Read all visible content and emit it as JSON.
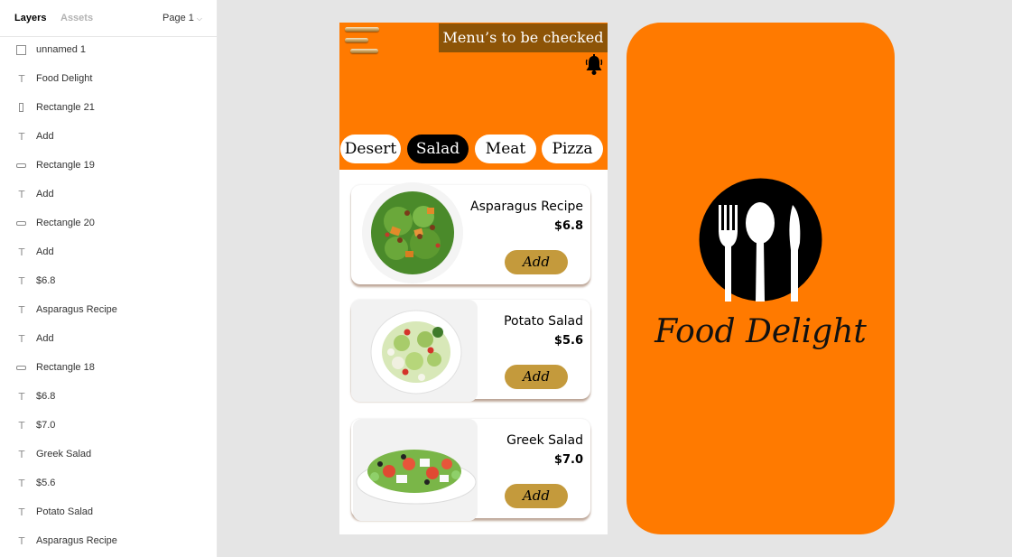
{
  "panel": {
    "tabs": {
      "layers": "Layers",
      "assets": "Assets"
    },
    "page": "Page 1",
    "layers": [
      {
        "label": "unnamed 1",
        "kind": "image"
      },
      {
        "label": "Food Delight",
        "kind": "text"
      },
      {
        "label": "Rectangle 21",
        "kind": "rect-v"
      },
      {
        "label": "Add",
        "kind": "text"
      },
      {
        "label": "Rectangle 19",
        "kind": "rect-h"
      },
      {
        "label": "Add",
        "kind": "text"
      },
      {
        "label": "Rectangle 20",
        "kind": "rect-h"
      },
      {
        "label": "Add",
        "kind": "text"
      },
      {
        "label": "$6.8",
        "kind": "text"
      },
      {
        "label": "Asparagus Recipe",
        "kind": "text"
      },
      {
        "label": "Add",
        "kind": "text"
      },
      {
        "label": "Rectangle 18",
        "kind": "rect-h"
      },
      {
        "label": "$6.8",
        "kind": "text"
      },
      {
        "label": "$7.0",
        "kind": "text"
      },
      {
        "label": "Greek Salad",
        "kind": "text"
      },
      {
        "label": "$5.6",
        "kind": "text"
      },
      {
        "label": "Potato Salad",
        "kind": "text"
      },
      {
        "label": "Asparagus Recipe",
        "kind": "text"
      }
    ]
  },
  "menu_screen": {
    "banner": "Menu’s to be checked",
    "categories": [
      "Desert",
      "Salad",
      "Meat",
      "Pizza"
    ],
    "active_category": "Salad",
    "items": [
      {
        "name": "Asparagus Recipe",
        "price": "$6.8",
        "add": "Add"
      },
      {
        "name": "Potato Salad",
        "price": "$5.6",
        "add": "Add"
      },
      {
        "name": "Greek Salad",
        "price": "$7.0",
        "add": "Add"
      }
    ]
  },
  "splash_screen": {
    "brand": "Food Delight"
  },
  "colors": {
    "orange": "#ff7a00",
    "banner": "#8d5407",
    "add_button": "#c49a3c",
    "canvas": "#e5e5e5"
  },
  "icons": [
    "hamburger-icon",
    "bell-icon",
    "cutlery-logo-icon",
    "text-layer-icon",
    "rectangle-layer-icon",
    "image-layer-icon"
  ]
}
